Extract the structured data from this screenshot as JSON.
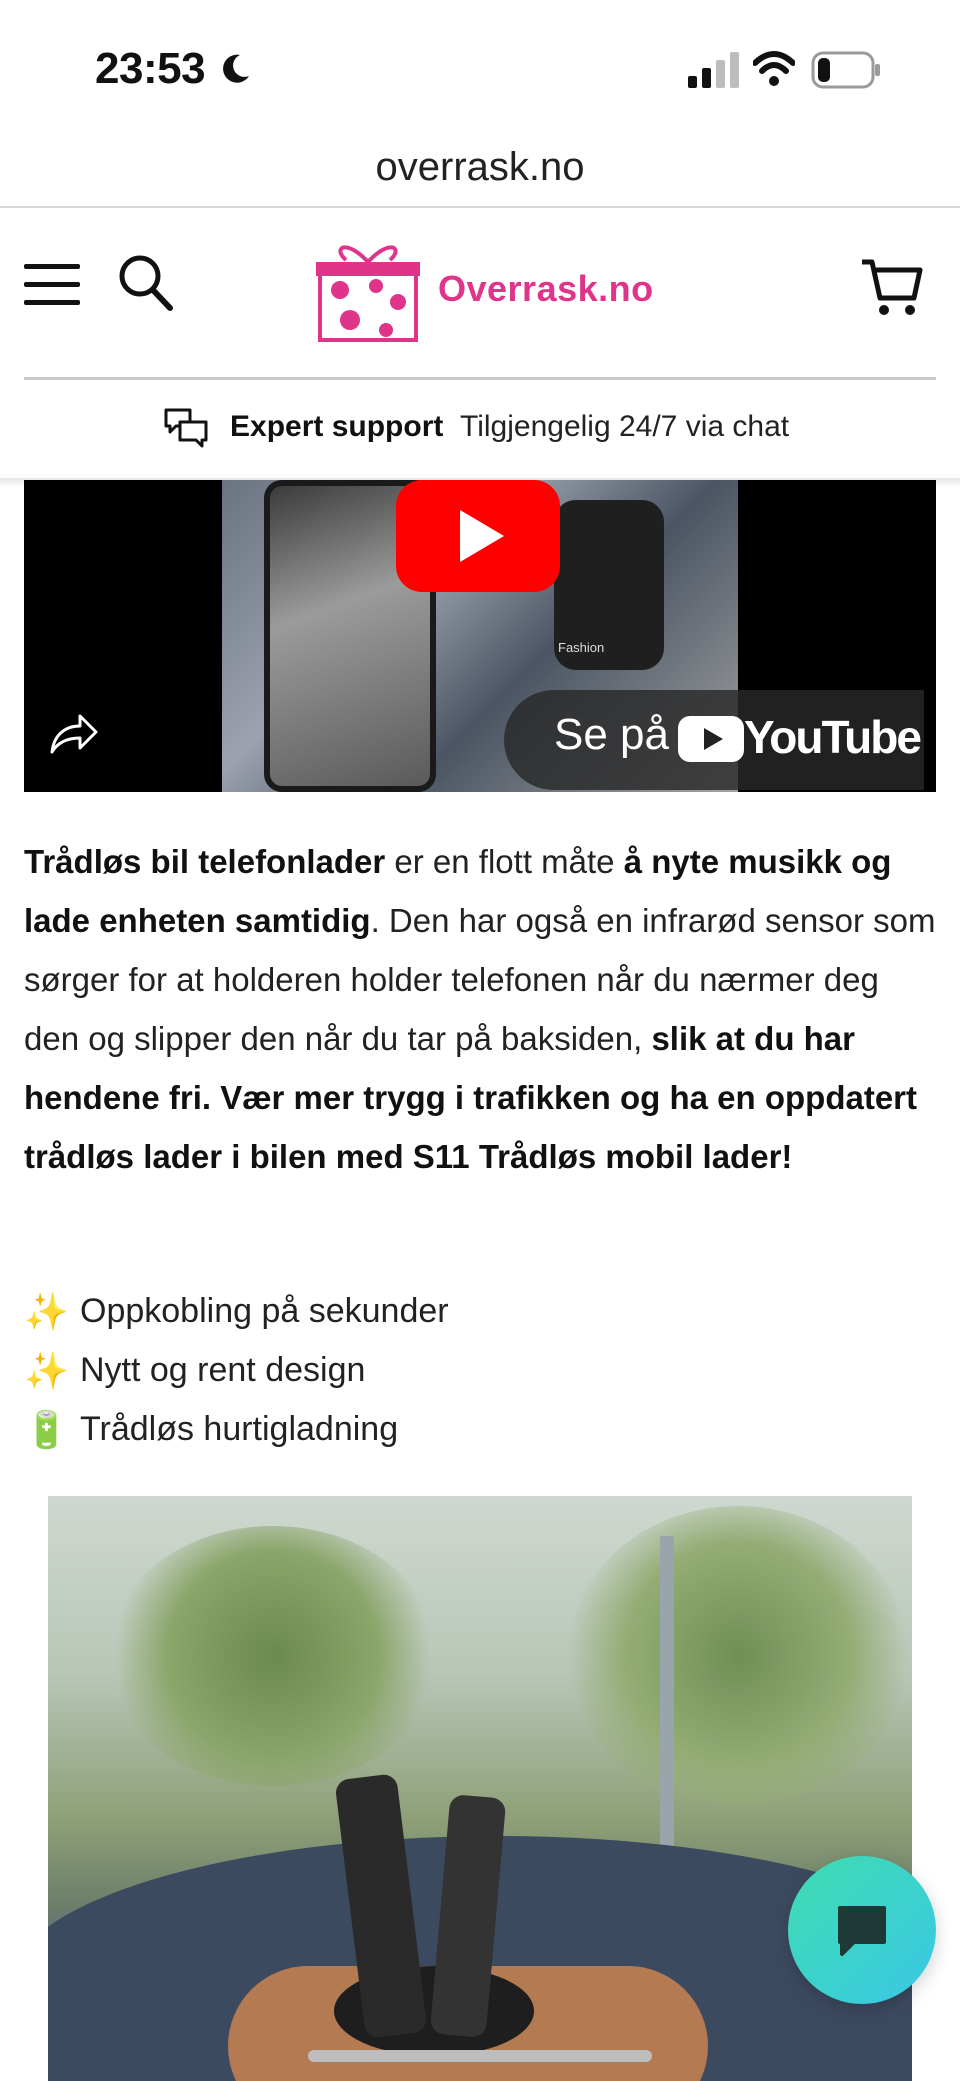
{
  "status": {
    "time": "23:53"
  },
  "browser": {
    "url": "overrask.no"
  },
  "header": {
    "logo_text": "Overrask.no"
  },
  "support": {
    "strong": "Expert support",
    "text": "Tilgjengelig 24/7 via chat"
  },
  "video": {
    "thumb_text": "Fashion",
    "watch_label": "Se på",
    "youtube_word": "YouTube"
  },
  "description": {
    "s1": "Trådløs bil telefonlader",
    "s2": " er en flott måte ",
    "s3": "å nyte musikk og lade enheten samtidig",
    "s4": ". Den har også en infrarød sensor som sørger for at holderen holder telefonen når du nærmer deg den og slipper den når du tar på baksiden, ",
    "s5": "slik at du har hendene fri. Vær  mer trygg i trafikken og ha en oppdatert trådløs lader i bilen med S11 Trådløs mobil lader!"
  },
  "features": [
    {
      "emoji": "✨",
      "label": "Oppkobling på sekunder"
    },
    {
      "emoji": "✨",
      "label": "Nytt og rent design"
    },
    {
      "emoji": "🔋",
      "label": "Trådløs hurtigladning"
    }
  ],
  "colors": {
    "brand": "#e0348b",
    "chat_fab": "#3fdcb0",
    "youtube_red": "#ff0000"
  }
}
